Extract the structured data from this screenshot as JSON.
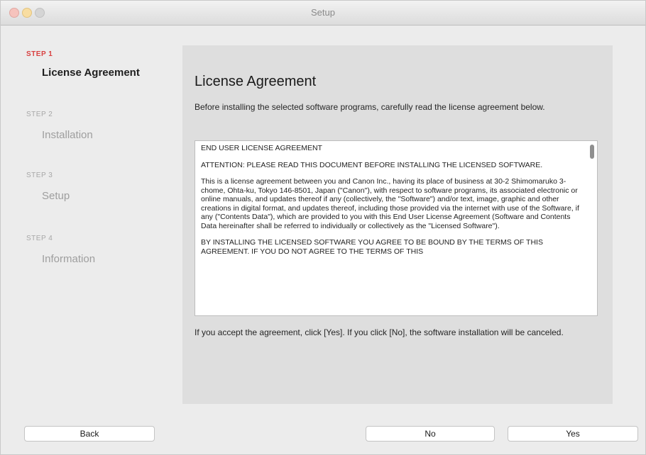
{
  "window": {
    "title": "Setup"
  },
  "sidebar": {
    "steps": [
      {
        "label": "STEP 1",
        "name": "License Agreement",
        "active": true
      },
      {
        "label": "STEP 2",
        "name": "Installation",
        "active": false
      },
      {
        "label": "STEP 3",
        "name": "Setup",
        "active": false
      },
      {
        "label": "STEP 4",
        "name": "Information",
        "active": false
      }
    ]
  },
  "main": {
    "heading": "License Agreement",
    "intro": "Before installing the selected software programs, carefully read the license agreement below.",
    "license": {
      "paragraphs": [
        "END USER LICENSE AGREEMENT",
        "ATTENTION: PLEASE READ THIS DOCUMENT BEFORE INSTALLING THE LICENSED SOFTWARE.",
        "This is a license agreement between you and Canon Inc., having its place of business at 30-2 Shimomaruko 3-chome, Ohta-ku, Tokyo 146-8501, Japan (\"Canon\"), with respect to software programs, its associated electronic or online manuals, and updates thereof if any (collectively, the \"Software\") and/or text, image, graphic and other creations in digital format, and updates thereof, including those provided via the internet with use of the Software, if any (\"Contents Data\"), which are provided to you with this End User License Agreement (Software and Contents Data hereinafter shall be referred to individually or collectively as the \"Licensed Software\").",
        "BY INSTALLING THE LICENSED SOFTWARE YOU AGREE TO BE BOUND BY THE TERMS OF THIS AGREEMENT. IF YOU DO NOT AGREE TO THE TERMS OF THIS"
      ]
    },
    "footer_note": "If you accept the agreement, click [Yes]. If you click [No], the software installation will be canceled."
  },
  "buttons": {
    "back": "Back",
    "no": "No",
    "yes": "Yes"
  }
}
